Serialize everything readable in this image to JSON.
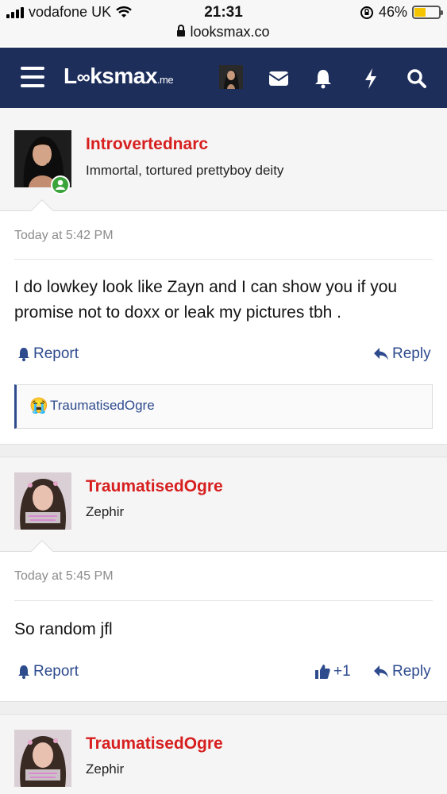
{
  "status_bar": {
    "carrier": "vodafone UK",
    "time": "21:31",
    "battery": "46%",
    "battery_level": 0.46,
    "url": "looksmax.co"
  },
  "nav": {
    "logo_main": "L",
    "logo_oo": "∞",
    "logo_rest": "ksmax",
    "logo_suffix": ".me",
    "icons": [
      "menu-icon",
      "avatar",
      "envelope-icon",
      "bell-icon",
      "bolt-icon",
      "search-icon"
    ],
    "colors": {
      "bar": "#1d2e5b",
      "link": "#2e4b8e",
      "author": "#d71f1f"
    }
  },
  "posts": [
    {
      "author": "Introvertednarc",
      "user_title": "Immortal, tortured prettyboy deity",
      "online": true,
      "timestamp": "Today at 5:42 PM",
      "message": "I do lowkey look like Zayn and I can show you if you promise not to doxx or leak my pictures tbh .",
      "report_label": "Report",
      "reply_label": "Reply",
      "reactions": {
        "emoji": "😭",
        "user": "TraumatisedOgre"
      }
    },
    {
      "author": "TraumatisedOgre",
      "user_title": "Zephir",
      "timestamp": "Today at 5:45 PM",
      "message": "So random jfl",
      "report_label": "Report",
      "like_count": "+1",
      "reply_label": "Reply"
    },
    {
      "author": "TraumatisedOgre",
      "user_title": "Zephir"
    }
  ]
}
